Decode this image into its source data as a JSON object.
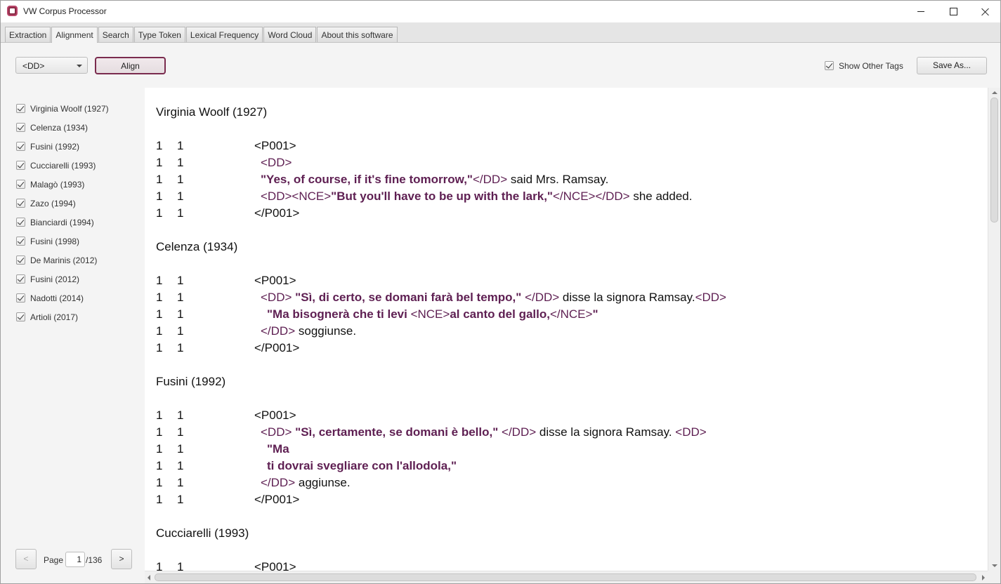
{
  "window": {
    "title": "VW Corpus Processor"
  },
  "tabs": [
    {
      "label": "Extraction"
    },
    {
      "label": "Alignment",
      "active": true
    },
    {
      "label": "Search"
    },
    {
      "label": "Type Token"
    },
    {
      "label": "Lexical Frequency"
    },
    {
      "label": "Word Cloud"
    },
    {
      "label": "About this software"
    }
  ],
  "toolbar": {
    "tag_select": "<DD>",
    "align_label": "Align",
    "show_other_tags_label": "Show Other Tags",
    "show_other_tags_checked": true,
    "save_as_label": "Save As..."
  },
  "translators": [
    {
      "label": "Virginia Woolf (1927)",
      "checked": true
    },
    {
      "label": "Celenza (1934)",
      "checked": true
    },
    {
      "label": "Fusini (1992)",
      "checked": true
    },
    {
      "label": "Cucciarelli (1993)",
      "checked": true
    },
    {
      "label": "Malagò (1993)",
      "checked": true
    },
    {
      "label": "Zazo (1994)",
      "checked": true
    },
    {
      "label": "Bianciardi (1994)",
      "checked": true
    },
    {
      "label": "Fusini (1998)",
      "checked": true
    },
    {
      "label": "De Marinis (2012)",
      "checked": true
    },
    {
      "label": "Fusini (2012)",
      "checked": true
    },
    {
      "label": "Nadotti (2014)",
      "checked": true
    },
    {
      "label": "Artioli (2017)",
      "checked": true
    }
  ],
  "pagination": {
    "prev_label": "<",
    "page_label": "Page",
    "current": "1",
    "total": "/136",
    "next_label": ">"
  },
  "alignment": [
    {
      "author": "Virginia Woolf (1927)",
      "lines": [
        {
          "n1": "1",
          "n2": "1",
          "indent": 0,
          "segments": [
            {
              "s": "<P001>",
              "k": "p"
            }
          ]
        },
        {
          "n1": "1",
          "n2": "1",
          "indent": 1,
          "segments": [
            {
              "s": "<DD>",
              "k": "t"
            }
          ]
        },
        {
          "n1": "1",
          "n2": "1",
          "indent": 1,
          "segments": [
            {
              "s": "\"Yes, of course, if it's fine tomorrow,\"",
              "k": "q"
            },
            {
              "s": "</DD>",
              "k": "t"
            },
            {
              "s": " said Mrs. Ramsay.",
              "k": "p"
            }
          ]
        },
        {
          "n1": "1",
          "n2": "1",
          "indent": 1,
          "segments": [
            {
              "s": "<DD>",
              "k": "t"
            },
            {
              "s": "<NCE>",
              "k": "t"
            },
            {
              "s": "\"But you'll have to be up with the lark,\"",
              "k": "q"
            },
            {
              "s": "</NCE>",
              "k": "t"
            },
            {
              "s": "</DD>",
              "k": "t"
            },
            {
              "s": " she added.",
              "k": "p"
            }
          ]
        },
        {
          "n1": "1",
          "n2": "1",
          "indent": 0,
          "segments": [
            {
              "s": "</P001>",
              "k": "p"
            }
          ]
        }
      ]
    },
    {
      "author": "Celenza (1934)",
      "lines": [
        {
          "n1": "1",
          "n2": "1",
          "indent": 0,
          "segments": [
            {
              "s": "<P001>",
              "k": "p"
            }
          ]
        },
        {
          "n1": "1",
          "n2": "1",
          "indent": 1,
          "segments": [
            {
              "s": "<DD> ",
              "k": "t"
            },
            {
              "s": "\"Sì, di certo, se domani farà bel tempo,\" ",
              "k": "q"
            },
            {
              "s": "</DD>",
              "k": "t"
            },
            {
              "s": " disse la signora Ramsay.",
              "k": "p"
            },
            {
              "s": "<DD>",
              "k": "t"
            }
          ]
        },
        {
          "n1": "1",
          "n2": "1",
          "indent": 2,
          "segments": [
            {
              "s": "\"Ma bisognerà che ti levi ",
              "k": "q"
            },
            {
              "s": "<NCE>",
              "k": "t"
            },
            {
              "s": "al canto del gallo,",
              "k": "q"
            },
            {
              "s": "</NCE>",
              "k": "t"
            },
            {
              "s": "\"",
              "k": "q"
            }
          ]
        },
        {
          "n1": "1",
          "n2": "1",
          "indent": 1,
          "segments": [
            {
              "s": "</DD>",
              "k": "t"
            },
            {
              "s": " soggiunse.",
              "k": "p"
            }
          ]
        },
        {
          "n1": "1",
          "n2": "1",
          "indent": 0,
          "segments": [
            {
              "s": "</P001>",
              "k": "p"
            }
          ]
        }
      ]
    },
    {
      "author": "Fusini (1992)",
      "lines": [
        {
          "n1": "1",
          "n2": "1",
          "indent": 0,
          "segments": [
            {
              "s": "<P001>",
              "k": "p"
            }
          ]
        },
        {
          "n1": "1",
          "n2": "1",
          "indent": 1,
          "segments": [
            {
              "s": "<DD> ",
              "k": "t"
            },
            {
              "s": "\"Sì, certamente, se domani è bello,\" ",
              "k": "q"
            },
            {
              "s": "</DD>",
              "k": "t"
            },
            {
              "s": " disse la signora Ramsay. ",
              "k": "p"
            },
            {
              "s": "<DD>",
              "k": "t"
            }
          ]
        },
        {
          "n1": "1",
          "n2": "1",
          "indent": 2,
          "segments": [
            {
              "s": "\"Ma",
              "k": "q"
            }
          ]
        },
        {
          "n1": "1",
          "n2": "1",
          "indent": 2,
          "segments": [
            {
              "s": "ti dovrai svegliare con l'allodola,\"",
              "k": "q"
            }
          ]
        },
        {
          "n1": "1",
          "n2": "1",
          "indent": 1,
          "segments": [
            {
              "s": "</DD>",
              "k": "t"
            },
            {
              "s": " aggiunse.",
              "k": "p"
            }
          ]
        },
        {
          "n1": "1",
          "n2": "1",
          "indent": 0,
          "segments": [
            {
              "s": "</P001>",
              "k": "p"
            }
          ]
        }
      ]
    },
    {
      "author": "Cucciarelli (1993)",
      "lines": [
        {
          "n1": "1",
          "n2": "1",
          "indent": 0,
          "segments": [
            {
              "s": "<P001>",
              "k": "p"
            }
          ]
        }
      ]
    }
  ]
}
